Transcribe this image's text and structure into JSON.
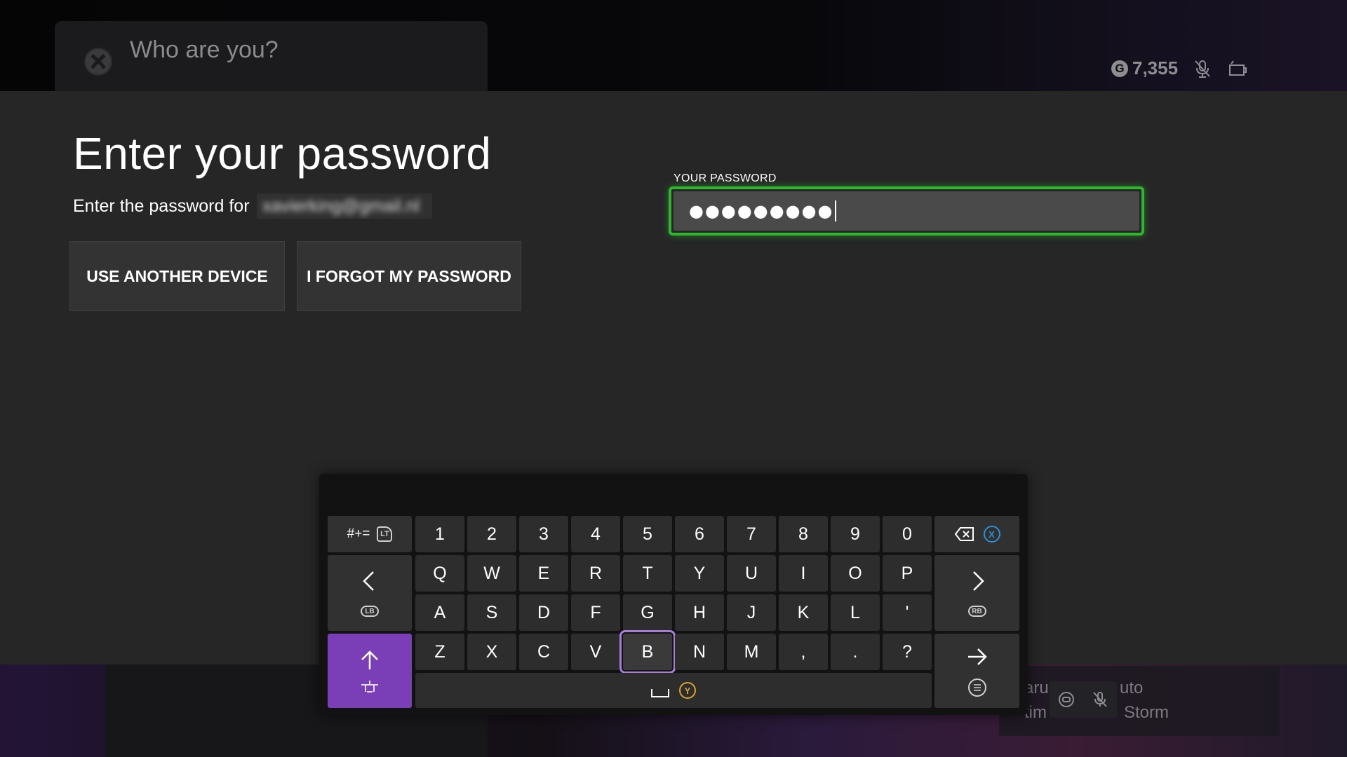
{
  "background": {
    "who_title": "Who are you?",
    "gamerscore": "7,355",
    "game_fragments": [
      "aru",
      "uto",
      "tim",
      "Storm"
    ]
  },
  "dialog": {
    "heading": "Enter your password",
    "subtext": "Enter the password for",
    "email_obscured": "xavierking@gmail.nl",
    "buttons": {
      "use_another_device": "USE ANOTHER DEVICE",
      "forgot_password": "I FORGOT MY PASSWORD"
    },
    "password_field": {
      "label": "YOUR PASSWORD",
      "masked_value": "●●●●●●●●●"
    }
  },
  "keyboard": {
    "symbols_key": "#+=",
    "number_row": [
      "1",
      "2",
      "3",
      "4",
      "5",
      "6",
      "7",
      "8",
      "9",
      "0"
    ],
    "row_q": [
      "Q",
      "W",
      "E",
      "R",
      "T",
      "Y",
      "U",
      "I",
      "O",
      "P"
    ],
    "row_a": [
      "A",
      "S",
      "D",
      "F",
      "G",
      "H",
      "J",
      "K",
      "L",
      "'"
    ],
    "row_z": [
      "Z",
      "X",
      "C",
      "V",
      "B",
      "N",
      "M",
      ",",
      ".",
      "?"
    ],
    "selected_key": "B",
    "hints": {
      "symbols": "LT",
      "backspace": "X",
      "left": "LB",
      "right": "RB",
      "space": "Y"
    }
  },
  "colors": {
    "focus_green": "#2fb52f",
    "shift_purple": "#7a3fb6",
    "selection_outline": "#a77fd9",
    "panel_bg": "#262626",
    "x_button_blue": "#2b8fd6",
    "y_button_yellow": "#d9a430"
  },
  "icons": {
    "logo": "xbox-logo-icon",
    "gamerscore": "gamerscore-g-icon",
    "mic": "mic-muted-icon",
    "battery": "battery-icon",
    "left": "arrow-left-icon",
    "right": "arrow-right-icon",
    "shift": "arrow-up-icon",
    "enter": "arrow-enter-icon",
    "backspace": "backspace-icon"
  }
}
